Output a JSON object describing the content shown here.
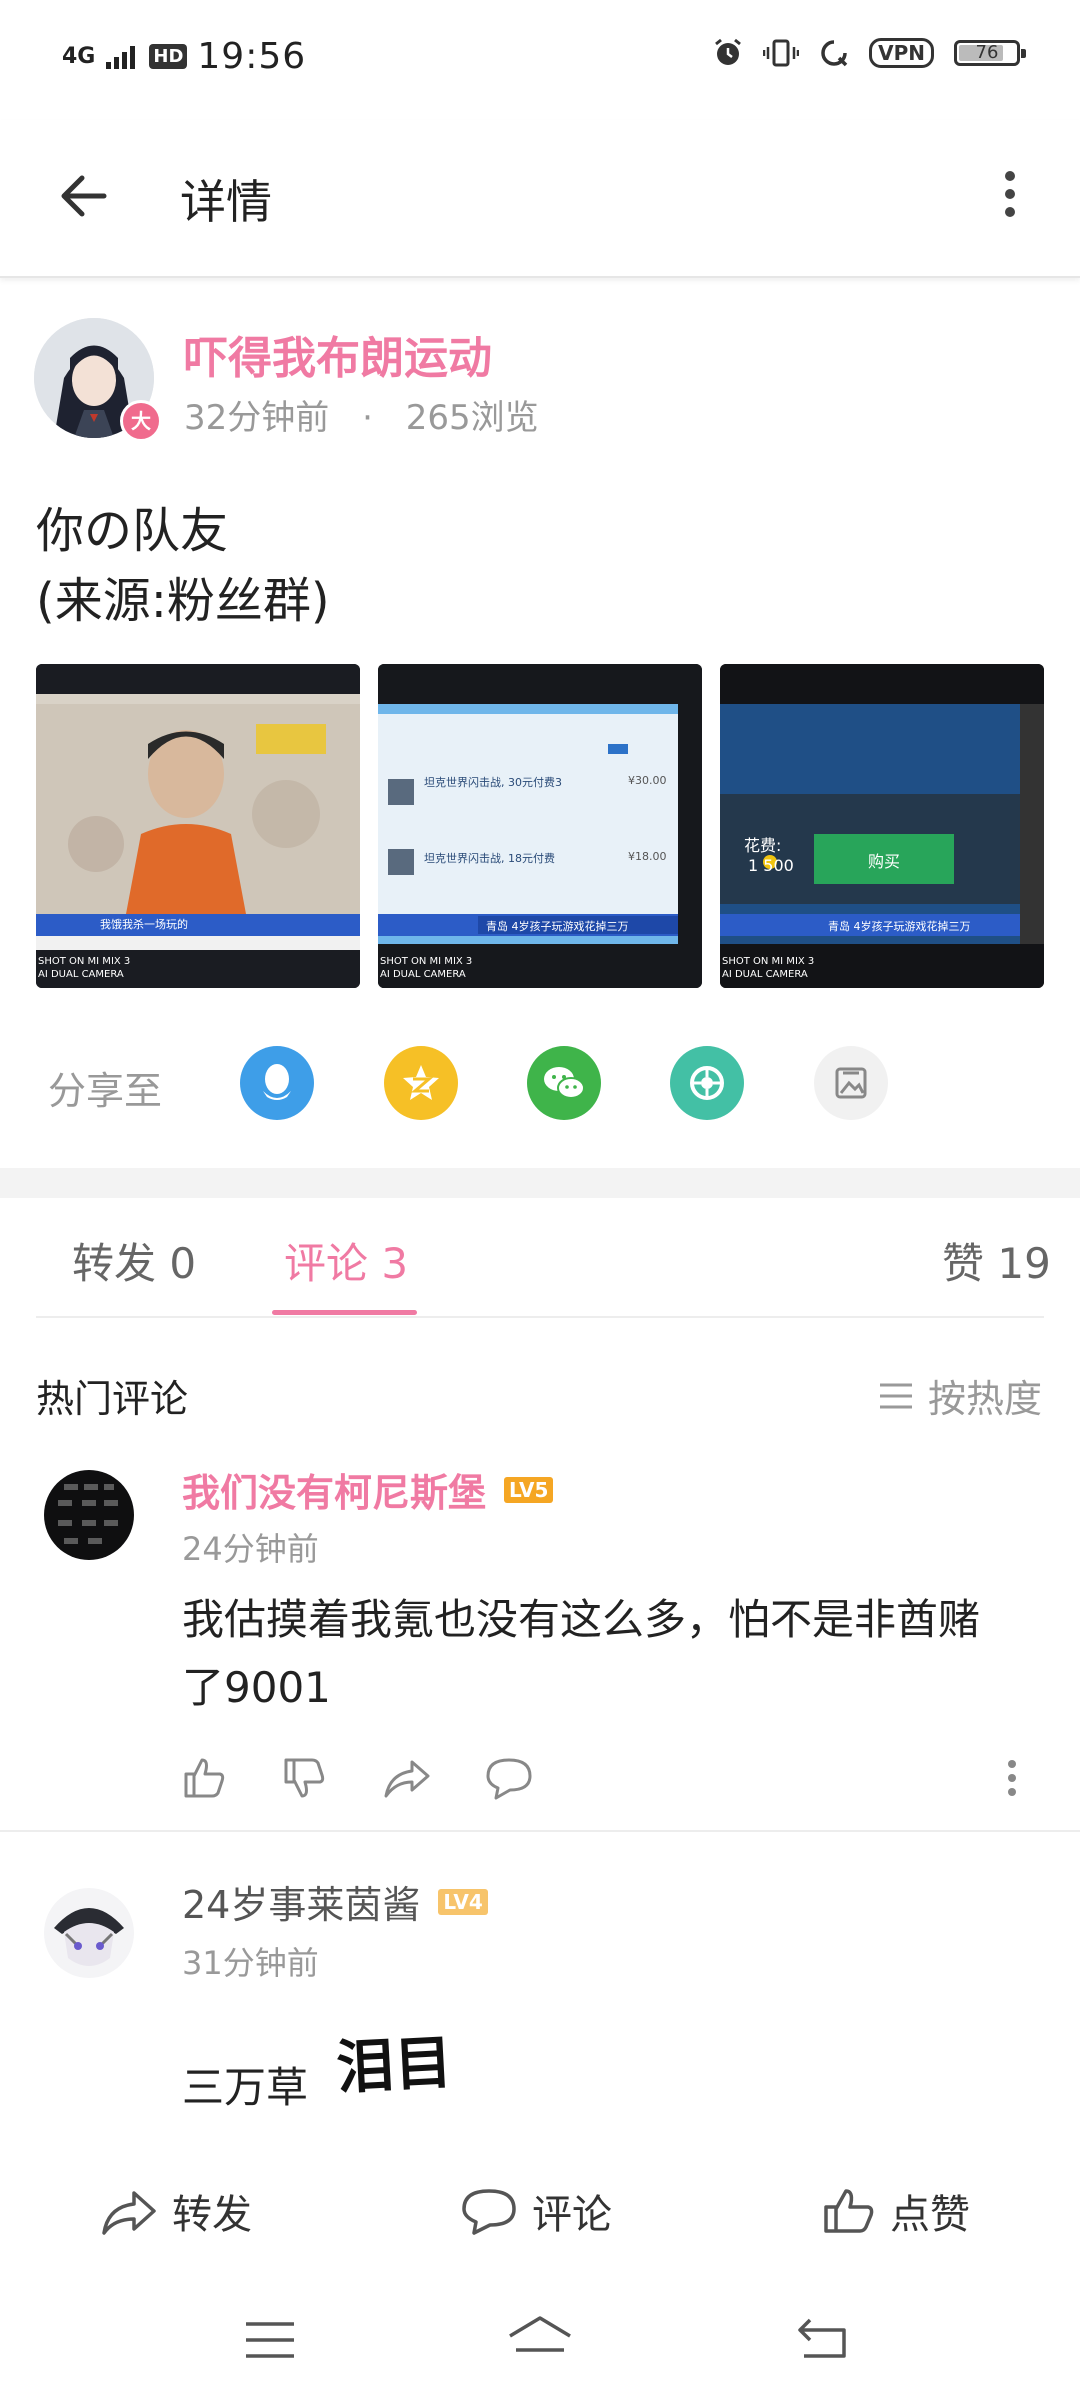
{
  "status_bar": {
    "time": "19:56",
    "network": "4G",
    "hd": "HD",
    "vpn": "VPN",
    "battery": "76"
  },
  "header": {
    "title": "详情"
  },
  "post": {
    "username": "吓得我布朗运动",
    "time": "32分钟前",
    "dot": "·",
    "views": "265浏览",
    "avatar_badge": "大",
    "line1": "你の队友",
    "line2": "(来源:粉丝群)",
    "images": [
      {
        "caption": "SHOT ON MI MIX 3",
        "caption2": "AI DUAL CAMERA",
        "ticker": "我饿我杀一场玩的"
      },
      {
        "caption": "SHOT ON MI MIX 3",
        "caption2": "AI DUAL CAMERA",
        "item1": "坦克世界闪击战, 30元付费3",
        "price1": "¥30.00",
        "item2": "坦克世界闪击战, 18元付费",
        "price2": "¥18.00",
        "ticker": "青岛  4岁孩子玩游戏花掉三万"
      },
      {
        "caption": "SHOT ON MI MIX 3",
        "caption2": "AI DUAL CAMERA",
        "cost_label": "花费:",
        "cost": "1 500",
        "buy": "购买",
        "ticker": "青岛  4岁孩子玩游戏花掉三万"
      }
    ]
  },
  "share": {
    "label": "分享至",
    "icons": [
      "qq-icon",
      "qzone-icon",
      "wechat-icon",
      "moments-icon",
      "gallery-icon"
    ]
  },
  "tabs": {
    "forward": "转发 0",
    "comments": "评论 3",
    "likes": "赞 19"
  },
  "hot_comments": {
    "title": "热门评论",
    "sort_label": "按热度"
  },
  "comments": [
    {
      "name": "我们没有柯尼斯堡",
      "level": "LV5",
      "time": "24分钟前",
      "text_line1": "我估摸着我氪也没有这么多，怕不是非酋赌",
      "text_line2": "了9001"
    },
    {
      "name": "24岁事莱茵酱",
      "level": "LV4",
      "time": "31分钟前",
      "text": "三万草",
      "sticker": "泪目"
    }
  ],
  "bottom_bar": {
    "forward": "转发",
    "comment": "评论",
    "like": "点赞"
  },
  "colors": {
    "accent": "#f07aa3",
    "lv5": "#f5a623",
    "lv4": "#f7c46b"
  }
}
